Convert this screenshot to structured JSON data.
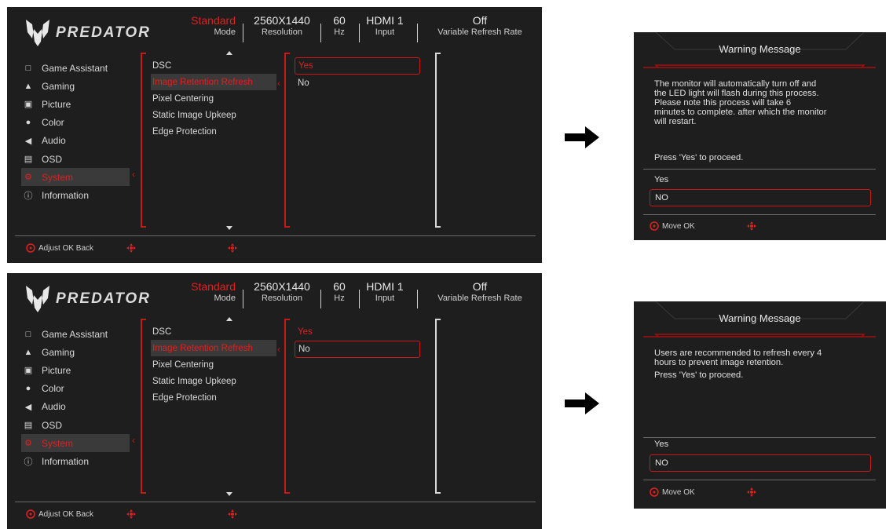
{
  "osd_panels": [
    {
      "brand": "PREDATOR",
      "status": {
        "mode_value": "Standard",
        "mode_label": "Mode",
        "resolution_value": "2560X1440",
        "resolution_label": "Resolution",
        "refresh_value": "60",
        "refresh_label": "Hz",
        "input_value": "HDMI 1",
        "input_label": "Input",
        "vrr_value": "Off",
        "vrr_label": "Variable Refresh Rate"
      },
      "sidebar": [
        {
          "label": "Game Assistant",
          "icon": "game-assistant-icon"
        },
        {
          "label": "Gaming",
          "icon": "gamepad-icon"
        },
        {
          "label": "Picture",
          "icon": "picture-icon"
        },
        {
          "label": "Color",
          "icon": "palette-icon"
        },
        {
          "label": "Audio",
          "icon": "speaker-icon"
        },
        {
          "label": "OSD",
          "icon": "osd-icon"
        },
        {
          "label": "System",
          "icon": "gear-icon",
          "active": true
        },
        {
          "label": "Information",
          "icon": "info-icon"
        }
      ],
      "submenu": [
        "DSC",
        "Image Retention Refresh",
        "Pixel Centering",
        "Static Image Upkeep",
        "Edge Protection"
      ],
      "submenu_active": "Image Retention Refresh",
      "options": [
        "Yes",
        "No"
      ],
      "option_selected": "Yes",
      "footer": "Adjust OK Back"
    },
    {
      "brand": "PREDATOR",
      "status": {
        "mode_value": "Standard",
        "mode_label": "Mode",
        "resolution_value": "2560X1440",
        "resolution_label": "Resolution",
        "refresh_value": "60",
        "refresh_label": "Hz",
        "input_value": "HDMI 1",
        "input_label": "Input",
        "vrr_value": "Off",
        "vrr_label": "Variable Refresh Rate"
      },
      "sidebar": [
        {
          "label": "Game Assistant",
          "icon": "game-assistant-icon"
        },
        {
          "label": "Gaming",
          "icon": "gamepad-icon"
        },
        {
          "label": "Picture",
          "icon": "picture-icon"
        },
        {
          "label": "Color",
          "icon": "palette-icon"
        },
        {
          "label": "Audio",
          "icon": "speaker-icon"
        },
        {
          "label": "OSD",
          "icon": "osd-icon"
        },
        {
          "label": "System",
          "icon": "gear-icon",
          "active": true
        },
        {
          "label": "Information",
          "icon": "info-icon"
        }
      ],
      "submenu": [
        "DSC",
        "Image Retention Refresh",
        "Pixel Centering",
        "Static Image Upkeep",
        "Edge Protection"
      ],
      "submenu_active": "Image Retention Refresh",
      "options": [
        "Yes",
        "No"
      ],
      "option_selected": "No",
      "footer": "Adjust OK Back"
    }
  ],
  "warnings": [
    {
      "title": "Warning Message",
      "body_lines": [
        "The monitor will automatically turn off and",
        "the LED light will flash during this process.",
        "Please note this process will take 6",
        "minutes to complete. after which the monitor",
        "will restart."
      ],
      "proceed": "Press 'Yes' to proceed.",
      "options": [
        "Yes",
        "NO"
      ],
      "option_selected": "NO",
      "footer": "Move OK"
    },
    {
      "title": "Warning Message",
      "body_lines": [
        "Users are recommended to refresh every 4",
        "hours to prevent image retention."
      ],
      "proceed": "Press 'Yes' to proceed.",
      "options": [
        "Yes",
        "NO"
      ],
      "option_selected": "NO",
      "footer": "Move OK"
    }
  ],
  "colors": {
    "panel_bg": "#1e1e1e",
    "accent_red": "#e02020",
    "text": "#d8d8d8",
    "highlight_bg": "#3a3a3a"
  }
}
